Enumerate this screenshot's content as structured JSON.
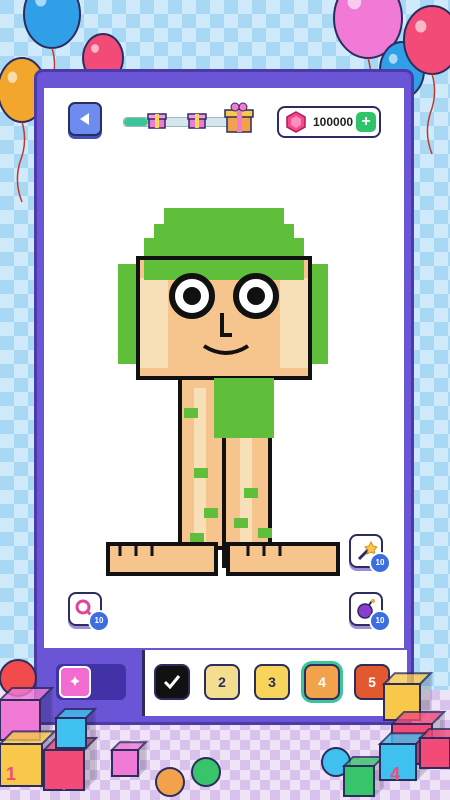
{
  "header": {
    "back_icon": "arrow-left-icon",
    "progress": 0.2,
    "gift_icons": [
      "gift-icon",
      "gift-icon",
      "gift-box-icon"
    ],
    "gems": {
      "icon": "gem-icon",
      "count": "100000",
      "add_icon": "plus-icon"
    }
  },
  "tools": {
    "magic_wand": {
      "icon": "magic-wand-icon",
      "count": "10"
    },
    "bomb": {
      "icon": "bomb-icon",
      "count": "10"
    },
    "magnifier": {
      "icon": "magnifier-icon",
      "count": "10"
    }
  },
  "hint": {
    "icon": "sparkle-icon"
  },
  "palette": [
    {
      "label": "",
      "color": "#111111",
      "icon": "check-icon",
      "done": true
    },
    {
      "label": "2",
      "color": "#f3dd8e"
    },
    {
      "label": "3",
      "color": "#f7d55a"
    },
    {
      "label": "4",
      "color": "#f2a24a",
      "selected": true
    },
    {
      "label": "5",
      "color": "#e2592f"
    }
  ],
  "colors": {
    "frame": "#6a55d6",
    "hair": "#5fbf3a",
    "skin": "#f6c58d",
    "skin_shadow": "#f7e0b8",
    "outline": "#111111"
  },
  "decorations": {
    "balloons": [
      "#2f9fe8",
      "#f24b77",
      "#f2a62b",
      "#f07ad6",
      "#2f9fe8",
      "#f24b77"
    ],
    "blocks": [
      "#3fc1f0",
      "#f24b77",
      "#f7c84a",
      "#38c46a",
      "#f07ad6"
    ],
    "block_letters": [
      "1",
      "7",
      "4"
    ]
  }
}
